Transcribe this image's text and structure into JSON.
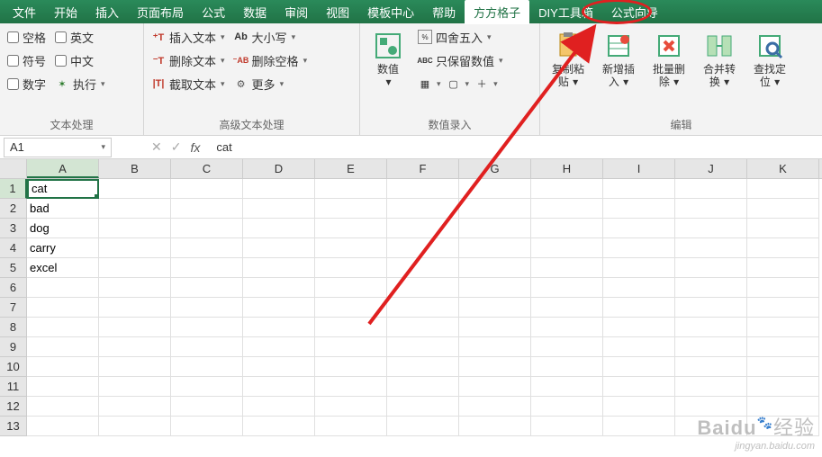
{
  "menubar": {
    "tabs": [
      "文件",
      "开始",
      "插入",
      "页面布局",
      "公式",
      "数据",
      "审阅",
      "视图",
      "模板中心",
      "帮助",
      "方方格子",
      "DIY工具箱",
      "公式向导"
    ],
    "active_index": 10
  },
  "ribbon": {
    "group1": {
      "label": "文本处理",
      "checks": [
        "空格",
        "英文",
        "符号",
        "中文",
        "数字",
        "执行"
      ]
    },
    "group2": {
      "label": "高级文本处理",
      "cmds": [
        "插入文本",
        "删除文本",
        "截取文本",
        "大小写",
        "删除空格",
        "更多"
      ]
    },
    "group3": {
      "label": "数值录入",
      "big": "数值",
      "cmds": [
        "四舍五入",
        "只保留数值"
      ]
    },
    "group4": {
      "label": "编辑",
      "btns": [
        {
          "l1": "复制粘",
          "l2": "贴"
        },
        {
          "l1": "新增插",
          "l2": "入"
        },
        {
          "l1": "批量删",
          "l2": "除"
        },
        {
          "l1": "合并转",
          "l2": "换"
        },
        {
          "l1": "查找定",
          "l2": "位"
        }
      ]
    }
  },
  "namebox": {
    "ref": "A1",
    "formula": "cat"
  },
  "sheet": {
    "columns": [
      "A",
      "B",
      "C",
      "D",
      "E",
      "F",
      "G",
      "H",
      "I",
      "J",
      "K"
    ],
    "rows": [
      1,
      2,
      3,
      4,
      5,
      6,
      7,
      8,
      9,
      10,
      11,
      12,
      13
    ],
    "active": {
      "r": 0,
      "c": 0
    },
    "data": {
      "0": {
        "0": "cat"
      },
      "1": {
        "0": "bad"
      },
      "2": {
        "0": "dog"
      },
      "3": {
        "0": "carry"
      },
      "4": {
        "0": "excel"
      }
    }
  },
  "watermark": {
    "brand": "Baidu",
    "suffix": "经验",
    "url": "jingyan.baidu.com"
  }
}
